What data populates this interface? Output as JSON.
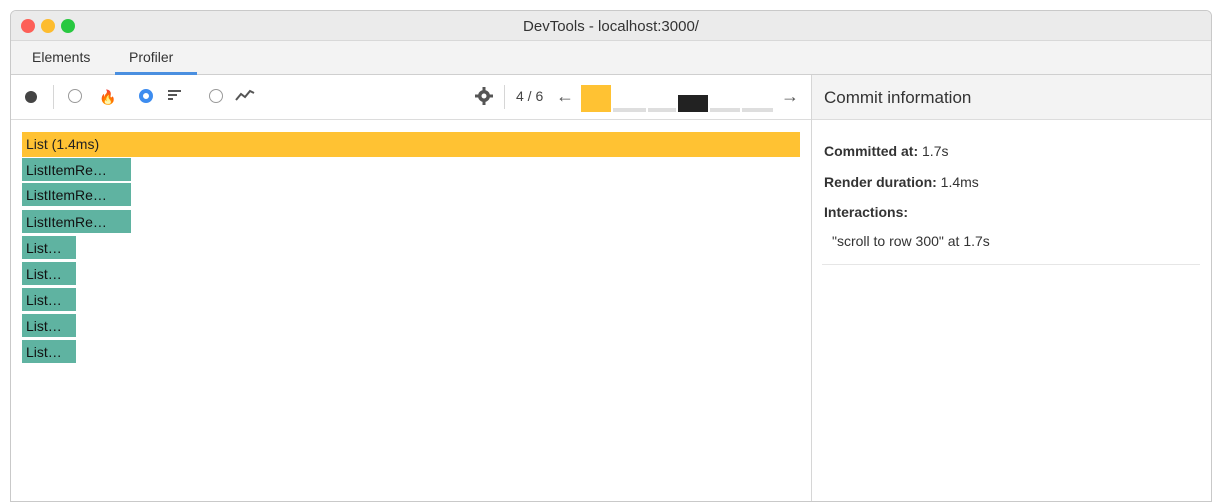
{
  "window": {
    "title": "DevTools - localhost:3000/"
  },
  "tabs": [
    {
      "label": "Elements"
    },
    {
      "label": "Profiler"
    }
  ],
  "toolbar": {
    "counter": "4 / 6"
  },
  "flame": {
    "root": {
      "label": "List (1.4ms)"
    },
    "children": [
      {
        "label": "ListItemRe…"
      },
      {
        "label": "ListItemRe…"
      },
      {
        "label": "ListItemRe…"
      },
      {
        "label": "List…"
      },
      {
        "label": "List…"
      },
      {
        "label": "List…"
      },
      {
        "label": "List…"
      },
      {
        "label": "List…"
      }
    ]
  },
  "commit": {
    "header": "Commit information",
    "committed_at_label": "Committed at:",
    "committed_at_value": "1.7s",
    "render_duration_label": "Render duration:",
    "render_duration_value": "1.4ms",
    "interactions_label": "Interactions:",
    "interaction": "\"scroll to row 300\" at 1.7s"
  },
  "colors": {
    "selected": "#ffc233",
    "rendered": "#5fb3a1",
    "accent": "#3d8cef"
  },
  "icons": [
    "record-icon",
    "flame-chart-icon",
    "ranked-chart-icon",
    "interactions-chart-icon",
    "settings-gear-icon",
    "prev-arrow-icon",
    "next-arrow-icon"
  ]
}
